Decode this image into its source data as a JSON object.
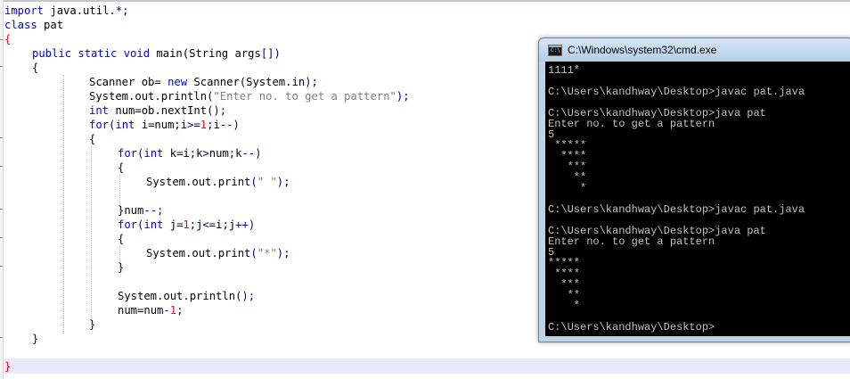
{
  "editor": {
    "lines": [
      {
        "text": "import java.util.*;"
      },
      {
        "text": "class pat"
      },
      {
        "text": "{"
      },
      {
        "text": "public static void main(String args[])"
      },
      {
        "text": "{"
      },
      {
        "text": "Scanner ob= new Scanner(System.in);"
      },
      {
        "text": "System.out.println(\"Enter no. to get a pattern\");"
      },
      {
        "text": "int num=ob.nextInt();"
      },
      {
        "text": "for(int i=num;i>=1;i--)"
      },
      {
        "text": "{"
      },
      {
        "text": "for(int k=i;k>num;k--)"
      },
      {
        "text": "{"
      },
      {
        "text": "System.out.print(\" \");"
      },
      {
        "text": ""
      },
      {
        "text": "}num--;"
      },
      {
        "text": "for(int j=1;j<=i;j++)"
      },
      {
        "text": "{"
      },
      {
        "text": "System.out.print(\"*\");"
      },
      {
        "text": "}"
      },
      {
        "text": ""
      },
      {
        "text": "System.out.println();"
      },
      {
        "text": "num=num-1;"
      },
      {
        "text": "}"
      },
      {
        "text": "}"
      },
      {
        "text": ""
      },
      {
        "text": "}"
      }
    ]
  },
  "cmd": {
    "title": "C:\\Windows\\system32\\cmd.exe",
    "icon": "console-icon",
    "icon_glyph": "C:\\",
    "lines": [
      "1111*",
      "",
      "C:\\Users\\kandhway\\Desktop>javac pat.java",
      "",
      "C:\\Users\\kandhway\\Desktop>java pat",
      "Enter no. to get a pattern",
      "5",
      " *****",
      "  ****",
      "   ***",
      "    **",
      "     *",
      "",
      "C:\\Users\\kandhway\\Desktop>javac pat.java",
      "",
      "C:\\Users\\kandhway\\Desktop>java pat",
      "Enter no. to get a pattern",
      "5",
      "*****",
      " ****",
      "  ***",
      "   **",
      "    *",
      "",
      "C:\\Users\\kandhway\\Desktop>"
    ]
  }
}
